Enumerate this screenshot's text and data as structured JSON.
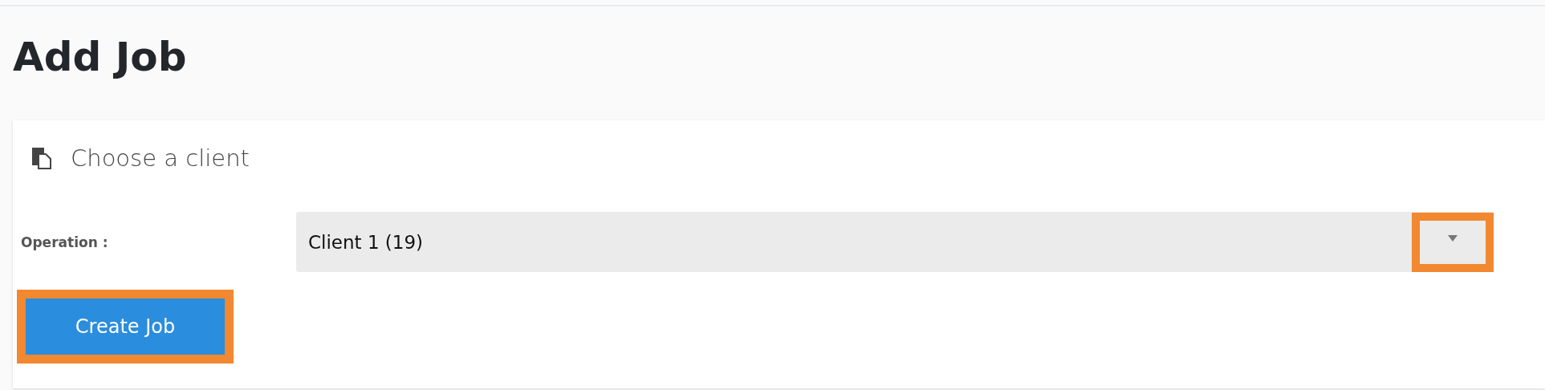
{
  "page": {
    "title": "Add Job"
  },
  "card": {
    "heading": "Choose a client",
    "field": {
      "label": "Operation :",
      "value": "Client 1 (19)",
      "highlighted_arrow": true
    },
    "button": {
      "label": "Create Job",
      "highlighted": true
    }
  }
}
